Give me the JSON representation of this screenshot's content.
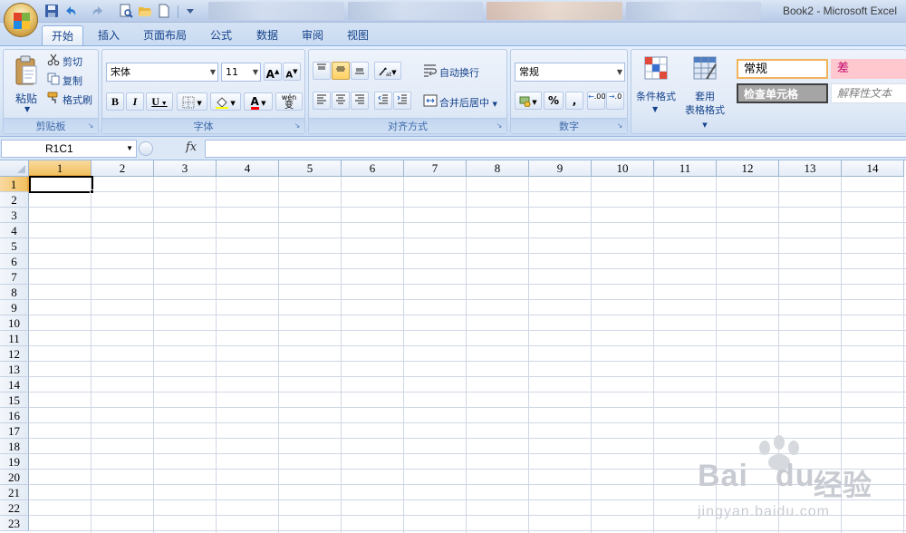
{
  "window": {
    "title": "Book2 - Microsoft Excel"
  },
  "ribbon_tabs": [
    "开始",
    "插入",
    "页面布局",
    "公式",
    "数据",
    "审阅",
    "视图"
  ],
  "active_tab": "开始",
  "clipboard": {
    "group_label": "剪贴板",
    "paste": "粘贴",
    "cut": "剪切",
    "copy": "复制",
    "format_painter": "格式刷"
  },
  "font": {
    "group_label": "字体",
    "font_name": "宋体",
    "font_size": "11",
    "grow": "A",
    "shrink": "A",
    "bold": "B",
    "italic": "I",
    "underline": "U",
    "font_color_glyph": "A",
    "phonetic_glyph": "wén",
    "phonetic_char": "变"
  },
  "alignment": {
    "group_label": "对齐方式",
    "wrap_text": "自动换行",
    "merge_center": "合并后居中"
  },
  "number": {
    "group_label": "数字",
    "format": "常规",
    "percent": "%",
    "comma": ",",
    "inc_decimal": ".00",
    "dec_decimal": ".0"
  },
  "styles": {
    "conditional_format": "条件格式",
    "format_as_table_line1": "套用",
    "format_as_table_line2": "表格格式",
    "normal": "常规",
    "bad": "差",
    "check_cell": "检查单元格",
    "explanatory": "解释性文本"
  },
  "formula_bar": {
    "name_box": "R1C1",
    "fx": "fx",
    "formula": ""
  },
  "grid": {
    "columns": [
      "1",
      "2",
      "3",
      "4",
      "5",
      "6",
      "7",
      "8",
      "9",
      "10",
      "11",
      "12",
      "13",
      "14"
    ],
    "rows": [
      "1",
      "2",
      "3",
      "4",
      "5",
      "6",
      "7",
      "8",
      "9",
      "10",
      "11",
      "12",
      "13",
      "14",
      "15",
      "16",
      "17",
      "18",
      "19",
      "20",
      "21",
      "22",
      "23"
    ],
    "active_column": "1",
    "active_row": "1"
  },
  "watermark": {
    "brand": "Bai",
    "brand2": "du",
    "cn": "经验",
    "url": "jingyan.baidu.com"
  },
  "colors": {
    "ribbon_text": "#15428b",
    "selected_header": "#f1c15f",
    "bad_fill": "#ffc7ce",
    "bad_text": "#c0006a"
  }
}
